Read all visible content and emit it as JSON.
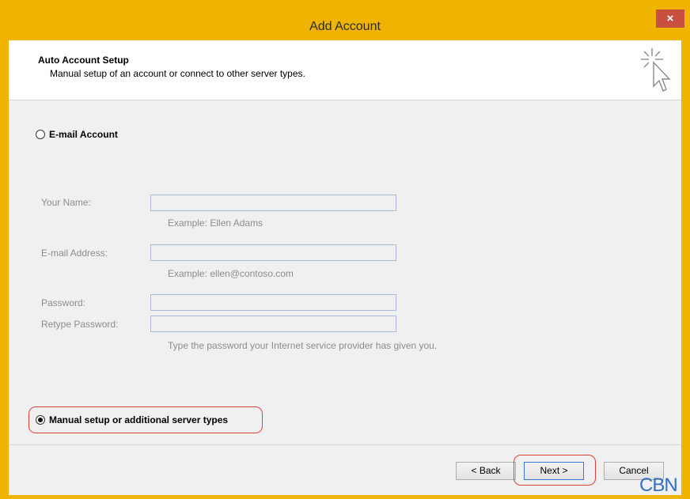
{
  "window": {
    "title": "Add Account",
    "close_glyph": "×"
  },
  "header": {
    "title": "Auto Account Setup",
    "subtitle": "Manual setup of an account or connect to other server types.",
    "icon": "cursor-click-icon"
  },
  "options": {
    "email_account": {
      "label": "E-mail Account",
      "selected": false
    },
    "manual_setup": {
      "label": "Manual setup or additional server types",
      "selected": true
    }
  },
  "form": {
    "your_name": {
      "label": "Your Name:",
      "value": "",
      "hint": "Example: Ellen Adams"
    },
    "email_address": {
      "label": "E-mail Address:",
      "value": "",
      "hint": "Example: ellen@contoso.com"
    },
    "password": {
      "label": "Password:",
      "value": ""
    },
    "retype_password": {
      "label": "Retype Password:",
      "value": "",
      "hint": "Type the password your Internet service provider has given you."
    }
  },
  "buttons": {
    "back": "< Back",
    "next": "Next >",
    "cancel": "Cancel"
  },
  "watermark": "CBN",
  "colors": {
    "title_bar": "#f0b400",
    "close_button": "#c7503f",
    "highlight": "#e0403a",
    "watermark": "#2f6fc4"
  }
}
